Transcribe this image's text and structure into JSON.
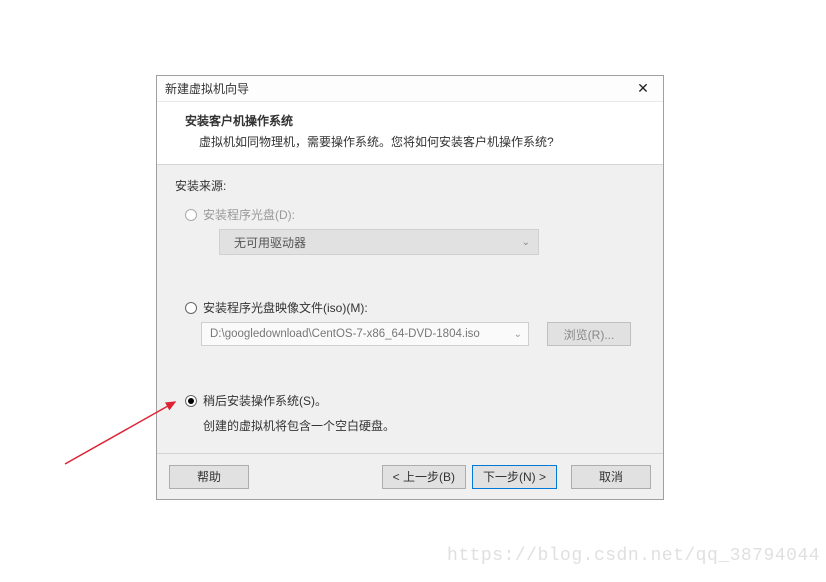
{
  "dialog": {
    "title": "新建虚拟机向导",
    "header_title": "安装客户机操作系统",
    "header_subtitle": "虚拟机如同物理机，需要操作系统。您将如何安装客户机操作系统?"
  },
  "source": {
    "section_label": "安装来源:",
    "option_disc": "安装程序光盘(D):",
    "disc_dropdown_value": "无可用驱动器",
    "option_iso": "安装程序光盘映像文件(iso)(M):",
    "iso_path": "D:\\googledownload\\CentOS-7-x86_64-DVD-1804.iso",
    "browse_label": "浏览(R)...",
    "option_later": "稍后安装操作系统(S)。",
    "later_note": "创建的虚拟机将包含一个空白硬盘。"
  },
  "buttons": {
    "help": "帮助",
    "back": "< 上一步(B)",
    "next": "下一步(N) >",
    "cancel": "取消"
  },
  "watermark": "https://blog.csdn.net/qq_38794044"
}
